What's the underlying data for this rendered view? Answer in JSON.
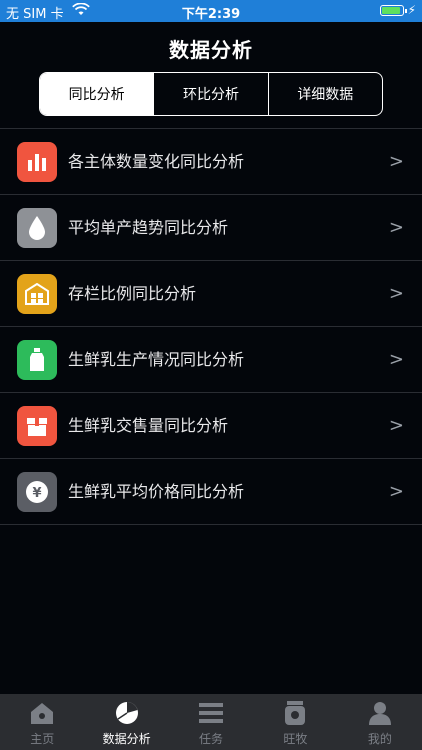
{
  "status": {
    "carrier": "无 SIM 卡",
    "time": "下午2:39"
  },
  "header": {
    "title": "数据分析"
  },
  "segments": [
    "同比分析",
    "环比分析",
    "详细数据"
  ],
  "list": [
    {
      "label": "各主体数量变化同比分析",
      "icon": "bar-chart-icon",
      "color": "#f0553f"
    },
    {
      "label": "平均单产趋势同比分析",
      "icon": "drop-icon",
      "color": "#8e9196"
    },
    {
      "label": "存栏比例同比分析",
      "icon": "barn-icon",
      "color": "#e3a31a"
    },
    {
      "label": "生鲜乳生产情况同比分析",
      "icon": "milk-bottle-icon",
      "color": "#2dbb5b"
    },
    {
      "label": "生鲜乳交售量同比分析",
      "icon": "sale-box-icon",
      "color": "#f0553f"
    },
    {
      "label": "生鲜乳平均价格同比分析",
      "icon": "yen-coin-icon",
      "color": "#5b5e65"
    }
  ],
  "tabbar": [
    {
      "label": "主页",
      "icon": "home-icon"
    },
    {
      "label": "数据分析",
      "icon": "pie-chart-icon",
      "active": true
    },
    {
      "label": "任务",
      "icon": "list-icon"
    },
    {
      "label": "旺牧",
      "icon": "jar-icon"
    },
    {
      "label": "我的",
      "icon": "person-icon"
    }
  ]
}
